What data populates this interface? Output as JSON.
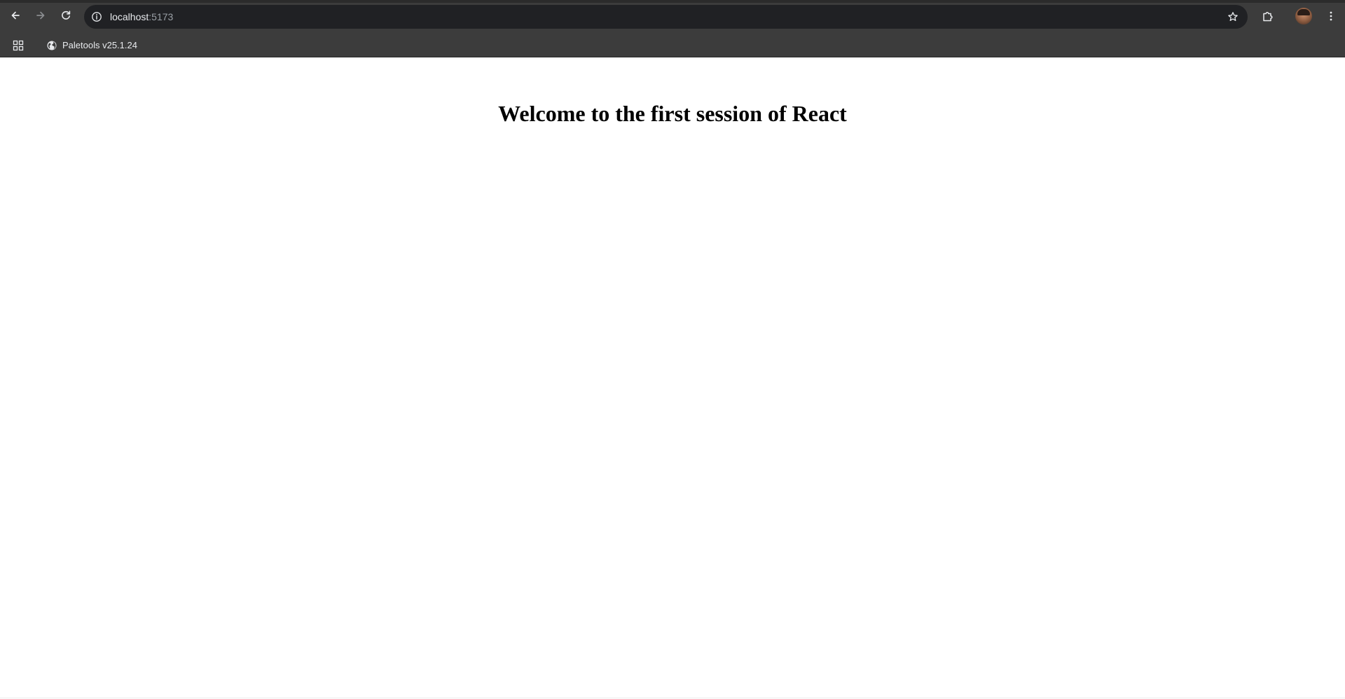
{
  "browser": {
    "url_host": "localhost",
    "url_port": ":5173",
    "bookmarks": [
      {
        "label": "Paletools v25.1.24",
        "icon": "globe-icon"
      }
    ],
    "icons": {
      "back": "arrow-left-icon",
      "forward": "arrow-right-icon",
      "reload": "reload-icon",
      "site_info": "info-icon",
      "bookmark_star": "star-icon",
      "extensions": "puzzle-icon",
      "profile": "avatar",
      "menu": "kebab-menu-icon",
      "apps": "apps-grid-icon"
    },
    "colors": {
      "toolbar": "#3c3c3c",
      "omnibox": "#202124",
      "text": "#e8eaed"
    }
  },
  "page": {
    "heading": "Welcome to the first session of React"
  }
}
